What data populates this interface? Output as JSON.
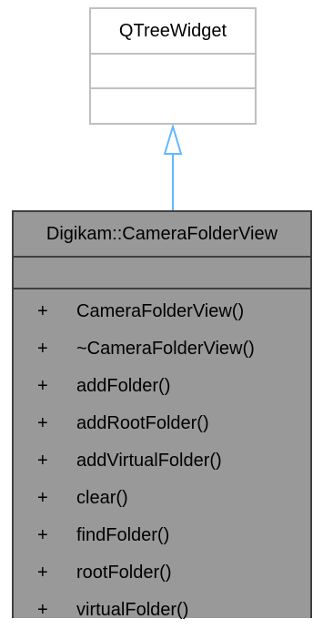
{
  "base_class": {
    "name": "QTreeWidget"
  },
  "derived_class": {
    "name": "Digikam::CameraFolderView",
    "methods": [
      {
        "visibility": "+",
        "name": "CameraFolderView()"
      },
      {
        "visibility": "+",
        "name": "~CameraFolderView()"
      },
      {
        "visibility": "+",
        "name": "addFolder()"
      },
      {
        "visibility": "+",
        "name": "addRootFolder()"
      },
      {
        "visibility": "+",
        "name": "addVirtualFolder()"
      },
      {
        "visibility": "+",
        "name": "clear()"
      },
      {
        "visibility": "+",
        "name": "findFolder()"
      },
      {
        "visibility": "+",
        "name": "rootFolder()"
      },
      {
        "visibility": "+",
        "name": "virtualFolder()"
      }
    ]
  },
  "relationship": {
    "type": "inheritance"
  },
  "colors": {
    "arrow": "#63b8ff",
    "derived_fill": "#999999",
    "derived_border": "#404040",
    "base_border": "#bfbfbf"
  }
}
